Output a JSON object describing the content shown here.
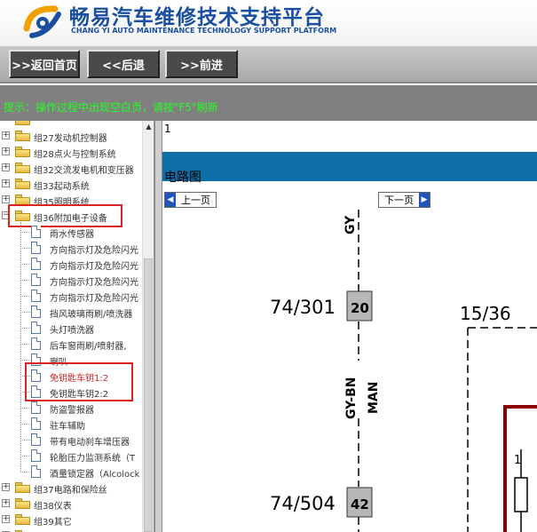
{
  "header": {
    "title": "畅易汽车维修技术支持平台",
    "subtitle": "CHANG YI AUTO MAINTENANCE TECHNOLOGY SUPPORT PLATFORM"
  },
  "toolbar": {
    "home_label": ">>返回首页",
    "back_label": "<<后退",
    "forward_label": ">>前进"
  },
  "notice": {
    "text": "提示：操作过程中出现空白页，请按\"F5\"刷新"
  },
  "sidebar": {
    "folders_top": [
      {
        "label": "组27发动机控制器"
      },
      {
        "label": "组28点火与控制系统"
      },
      {
        "label": "组32交流发电机和变压器"
      },
      {
        "label": "组33起动系统"
      },
      {
        "label": "组35照明系统"
      },
      {
        "label": "组36附加电子设备"
      }
    ],
    "documents": [
      {
        "label": "雨水传感器"
      },
      {
        "label": "方向指示灯及危险闪光"
      },
      {
        "label": "方向指示灯及危险闪光"
      },
      {
        "label": "方向指示灯及危险闪光"
      },
      {
        "label": "方向指示灯及危险闪光"
      },
      {
        "label": "挡风玻璃雨刷/喷洗器"
      },
      {
        "label": "头灯喷洗器"
      },
      {
        "label": "后车窗雨刷/喷射器,"
      },
      {
        "label": "喇叭"
      },
      {
        "label": "免钥匙车钥1:2"
      },
      {
        "label": "免钥匙车钥2:2"
      },
      {
        "label": "防盗警报器"
      },
      {
        "label": "驻车辅助"
      },
      {
        "label": "带有电动刹车增压器"
      },
      {
        "label": "轮胎压力监测系统（T"
      },
      {
        "label": "酒量锁定器（Alcolock"
      }
    ],
    "folders_bottom": [
      {
        "label": "组37电路和保险丝"
      },
      {
        "label": "组38仪表"
      },
      {
        "label": "组39其它"
      }
    ]
  },
  "main": {
    "page_number": "1",
    "section_title": "电路图",
    "prev_label": "上一页",
    "next_label": "下一页",
    "diagram": {
      "wire_top": "GY",
      "conn1_label": "74/301",
      "conn1_pin": "20",
      "conn2_label": "15/36",
      "wire_mid_a": "GY-BN",
      "wire_mid_b": "MAN",
      "conn3_label": "74/504",
      "conn3_pin": "42",
      "fuse_pin": "1"
    }
  }
}
